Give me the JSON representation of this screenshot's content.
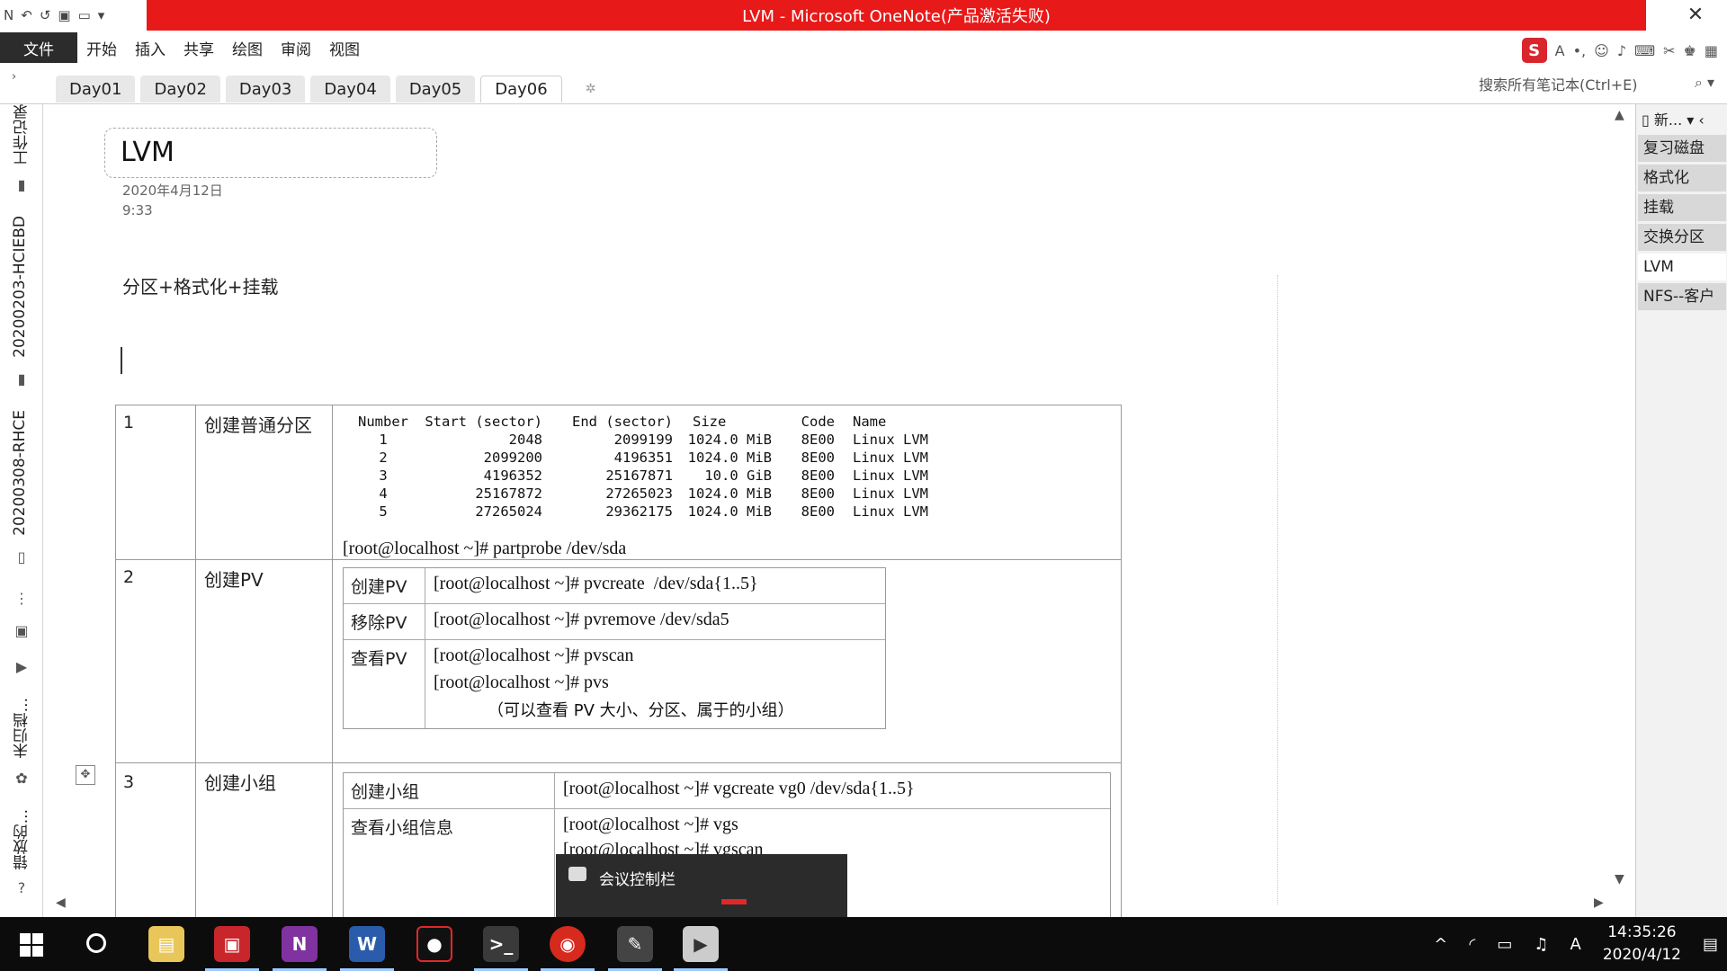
{
  "window": {
    "title": "LVM - Microsoft OneNote(产品激活失败)",
    "close_glyph": "✕"
  },
  "ribbon": {
    "file": "文件",
    "menus": [
      "开始",
      "插入",
      "共享",
      "绘图",
      "审阅",
      "视图"
    ],
    "ime_logo": "S"
  },
  "sections": {
    "tabs": [
      "Day01",
      "Day02",
      "Day03",
      "Day04",
      "Day05",
      "Day06"
    ],
    "active": "Day06",
    "add_tab": "✲"
  },
  "search": {
    "placeholder": "搜索所有笔记本(Ctrl+E)",
    "icon": "search-icon"
  },
  "notebooks": [
    "工作记录",
    "20200203-HCIEBD",
    "20200308-RHCE",
    "未归档...",
    "错放的..."
  ],
  "page": {
    "title": "LVM",
    "date": "2020年4月12日",
    "time": "9:33",
    "subheading": "分区+格式化+挂载"
  },
  "table": {
    "rows": [
      {
        "num": "1",
        "task": "创建普通分区"
      },
      {
        "num": "2",
        "task": "创建PV"
      },
      {
        "num": "3",
        "task": "创建小组"
      }
    ],
    "partitions": {
      "headers": [
        "Number",
        "Start (sector)",
        "End (sector)",
        "Size",
        "Code",
        "Name"
      ],
      "rows": [
        [
          "1",
          "2048",
          "2099199",
          "1024.0 MiB",
          "8E00",
          "Linux LVM"
        ],
        [
          "2",
          "2099200",
          "4196351",
          "1024.0 MiB",
          "8E00",
          "Linux LVM"
        ],
        [
          "3",
          "4196352",
          "25167871",
          "10.0 GiB",
          "8E00",
          "Linux LVM"
        ],
        [
          "4",
          "25167872",
          "27265023",
          "1024.0 MiB",
          "8E00",
          "Linux LVM"
        ],
        [
          "5",
          "27265024",
          "29362175",
          "1024.0 MiB",
          "8E00",
          "Linux LVM"
        ]
      ],
      "partprobe": "[root@localhost ~]# partprobe /dev/sda"
    },
    "pv": {
      "create_label": "创建PV",
      "create_cmd": "[root@localhost ~]# pvcreate  /dev/sda{1..5}",
      "remove_label": "移除PV",
      "remove_cmd": "[root@localhost ~]# pvremove /dev/sda5",
      "view_label": "查看PV",
      "view_cmd1": "[root@localhost ~]# pvscan",
      "view_cmd2": "[root@localhost ~]# pvs",
      "view_note": "（可以查看 PV 大小、分区、属于的小组）"
    },
    "vg": {
      "create_label": "创建小组",
      "create_cmd": "[root@localhost ~]# vgcreate vg0 /dev/sda{1..5}",
      "view_label": "查看小组信息",
      "view_cmd1": "[root@localhost ~]# vgs",
      "view_cmd2": "[root@localhost ~]# vgscan"
    }
  },
  "pages": {
    "new_label": "新...",
    "items": [
      "复习磁盘",
      "格式化",
      "挂载",
      "交换分区",
      "LVM",
      "NFS--客户"
    ],
    "active": "LVM"
  },
  "meeting": {
    "label": "会议控制栏"
  },
  "taskbar": {
    "time": "14:35:26",
    "date": "2020/4/12",
    "ime": "A"
  }
}
